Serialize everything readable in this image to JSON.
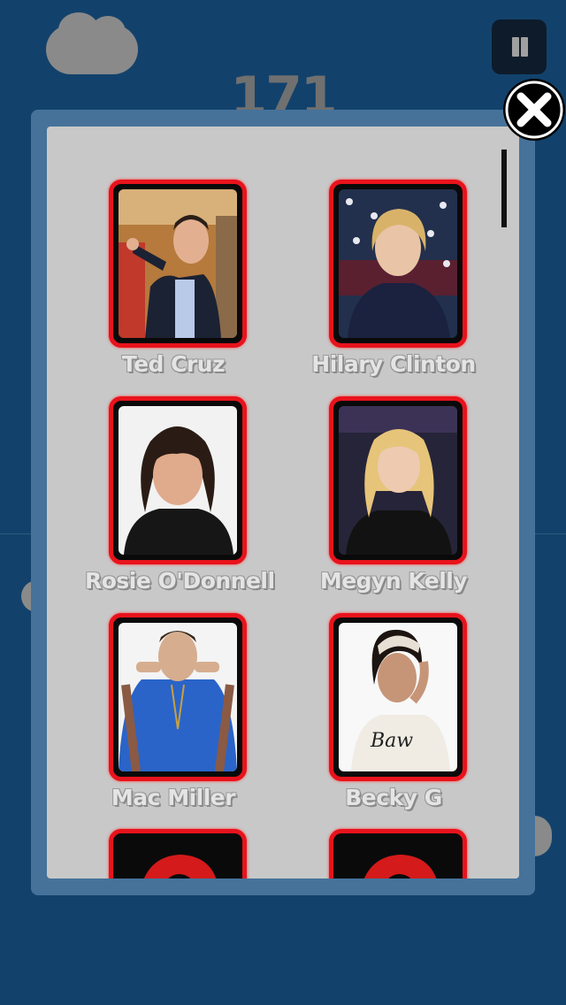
{
  "score": "171",
  "cards": [
    {
      "name": "Ted Cruz"
    },
    {
      "name": "Hilary Clinton"
    },
    {
      "name": "Rosie O'Donnell"
    },
    {
      "name": "Megyn Kelly"
    },
    {
      "name": "Mac Miller"
    },
    {
      "name": "Becky G"
    },
    {
      "name": ""
    },
    {
      "name": ""
    }
  ],
  "colors": {
    "background": "#12426c",
    "card_border": "#e8131c",
    "panel": "#c8c8c8"
  }
}
